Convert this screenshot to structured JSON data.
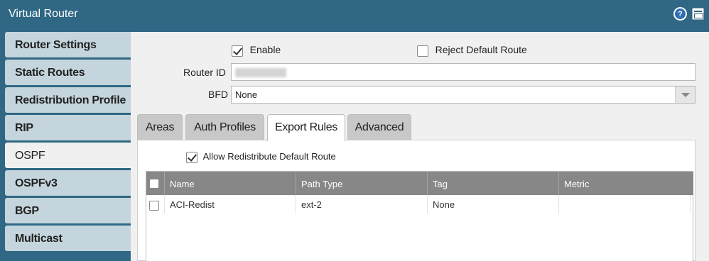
{
  "window": {
    "title": "Virtual Router",
    "help_icon_glyph": "?"
  },
  "sidebar": {
    "items": [
      {
        "label": "Router Settings"
      },
      {
        "label": "Static Routes"
      },
      {
        "label": "Redistribution Profile"
      },
      {
        "label": "RIP"
      },
      {
        "label": "OSPF"
      },
      {
        "label": "OSPFv3"
      },
      {
        "label": "BGP"
      },
      {
        "label": "Multicast"
      }
    ],
    "active": "OSPF"
  },
  "form": {
    "enable_label": "Enable",
    "enable_checked": true,
    "reject_default_label": "Reject Default Route",
    "reject_default_checked": false,
    "router_id_label": "Router ID",
    "bfd_label": "BFD",
    "bfd_value": "None"
  },
  "tabs": [
    {
      "label": "Areas"
    },
    {
      "label": "Auth Profiles"
    },
    {
      "label": "Export Rules"
    },
    {
      "label": "Advanced"
    }
  ],
  "active_tab": "Export Rules",
  "export_rules": {
    "allow_redistribute_label": "Allow Redistribute Default Route",
    "allow_redistribute_checked": true,
    "columns": [
      "Name",
      "Path Type",
      "Tag",
      "Metric"
    ],
    "rows": [
      {
        "name": "ACI-Redist",
        "path_type": "ext-2",
        "tag": "None",
        "metric": ""
      }
    ]
  },
  "colors": {
    "header_bg": "#2f6784",
    "nav_item_bg": "#c4d5dd",
    "content_bg": "#f0f0f0",
    "table_header_bg": "#878787"
  }
}
